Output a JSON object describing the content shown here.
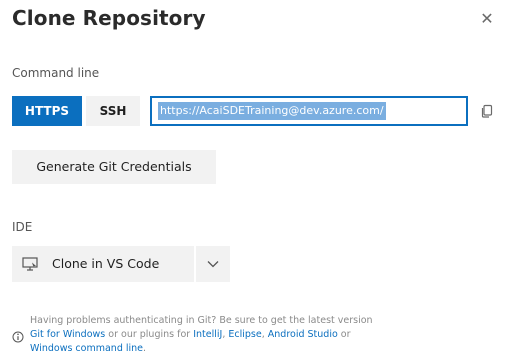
{
  "dialog": {
    "title": "Clone Repository",
    "close_glyph": "✕"
  },
  "command_line": {
    "label": "Command line",
    "https_label": "HTTPS",
    "ssh_label": "SSH",
    "url_value": "https://AcaiSDETraining@dev.azure.com/",
    "active_protocol": "HTTPS"
  },
  "generate_button": "Generate Git Credentials",
  "ide": {
    "label": "IDE",
    "clone_label": "Clone in VS Code"
  },
  "help": {
    "line1": "Having problems authenticating in Git? Be sure to get the latest version",
    "git_for_windows": "Git for Windows",
    "or_our_plugins": " or our plugins for ",
    "intellij": "IntelliJ",
    "comma": ", ",
    "eclipse": "Eclipse",
    "comma2": ", ",
    "android_studio": "Android Studio",
    "or": " or",
    "windows_command_line": "Windows command line",
    "period": "."
  },
  "colors": {
    "accent": "#0b6fbf",
    "button_bg": "#f2f2f2",
    "selection": "#7aaee0"
  },
  "icons": [
    "close-icon",
    "copy-icon",
    "vs-code-icon",
    "chevron-down-icon",
    "info-icon"
  ]
}
